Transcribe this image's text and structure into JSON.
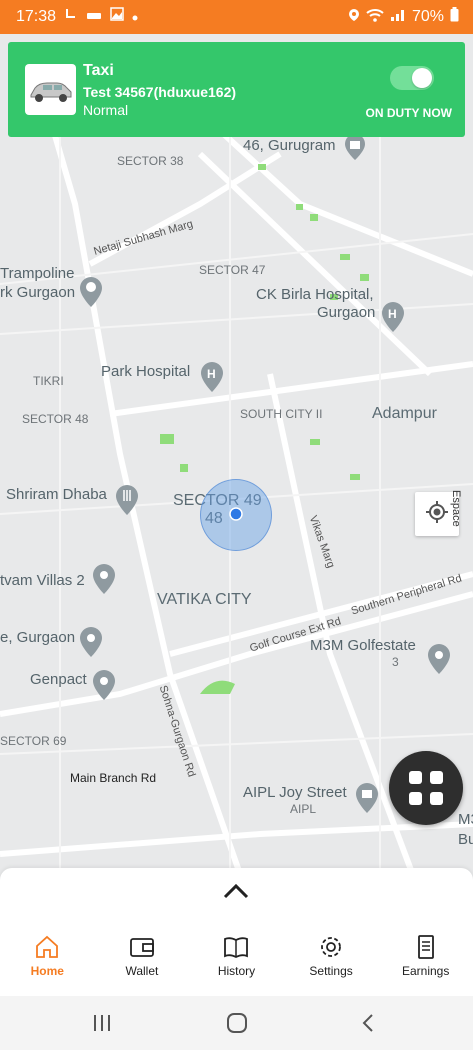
{
  "status_bar": {
    "time": "17:38",
    "battery": "70%"
  },
  "driver": {
    "service": "Taxi",
    "vehicle": "Test 34567(hduxue162)",
    "mode": "Normal",
    "duty_status": "ON DUTY NOW",
    "on_duty": true
  },
  "map": {
    "labels": {
      "sector38": "SECTOR 38",
      "gurugram": "46, Gurugram",
      "netaji": "Netaji Subhash Marg",
      "sector47": "SECTOR 47",
      "trampoline1": "Trampoline",
      "trampoline2": "rk Gurgaon",
      "ckbirla1": "CK Birla Hospital,",
      "ckbirla2": "Gurgaon",
      "tikri": "TIKRI",
      "park": "Park Hospital",
      "sector48": "SECTOR 48",
      "southcity": "SOUTH CITY II",
      "adampur": "Adampur",
      "shriram": "Shriram Dhaba",
      "sector49": "SECTOR 49",
      "sector49b": "48",
      "vikas": "Vikas Marg",
      "southern": "Southern Peripheral Rd",
      "tvam": "tvam Villas 2",
      "vatika": "VATIKA CITY",
      "golf": "Golf Course Ext Rd",
      "egurgaon": "e, Gurgaon",
      "m3m": "M3M Golfestate",
      "m3m3": "3",
      "genpact": "Genpact",
      "sohna": "Sohna-Gurgaon Rd",
      "sector69": "SECTOR 69",
      "mainbranch": "Main Branch Rd",
      "aipl": "AIPL Joy Street",
      "aipl2": "AIPL",
      "m3": "M3",
      "bu": "Bu"
    },
    "locate_hint": "Espace"
  },
  "nav": {
    "items": [
      {
        "label": "Home",
        "icon": "home-icon",
        "active": true
      },
      {
        "label": "Wallet",
        "icon": "wallet-icon"
      },
      {
        "label": "History",
        "icon": "book-icon"
      },
      {
        "label": "Settings",
        "icon": "gear-icon"
      },
      {
        "label": "Earnings",
        "icon": "receipt-icon"
      }
    ]
  },
  "colors": {
    "status_bar": "#f57c22",
    "driver_card": "#34c76b",
    "accent": "#f57c22"
  }
}
